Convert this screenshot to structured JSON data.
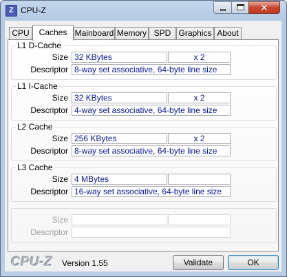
{
  "window": {
    "title": "CPU-Z",
    "icon_letter": "Z"
  },
  "tabs": [
    {
      "label": "CPU",
      "active": false
    },
    {
      "label": "Caches",
      "active": true
    },
    {
      "label": "Mainboard",
      "active": false
    },
    {
      "label": "Memory",
      "active": false
    },
    {
      "label": "SPD",
      "active": false
    },
    {
      "label": "Graphics",
      "active": false
    },
    {
      "label": "About",
      "active": false
    }
  ],
  "labels": {
    "size": "Size",
    "descriptor": "Descriptor"
  },
  "caches": {
    "l1d": {
      "title": "L1 D-Cache",
      "size": "32 KBytes",
      "count": "x 2",
      "descriptor": "8-way set associative, 64-byte line size"
    },
    "l1i": {
      "title": "L1 I-Cache",
      "size": "32 KBytes",
      "count": "x 2",
      "descriptor": "4-way set associative, 64-byte line size"
    },
    "l2": {
      "title": "L2 Cache",
      "size": "256 KBytes",
      "count": "x 2",
      "descriptor": "8-way set associative, 64-byte line size"
    },
    "l3": {
      "title": "L3 Cache",
      "size": "4 MBytes",
      "count": "",
      "descriptor": "16-way set associative, 64-byte line size"
    },
    "empty": {
      "size": "",
      "count": "",
      "descriptor": ""
    }
  },
  "footer": {
    "logo": "CPU-Z",
    "version": "Version 1.55",
    "validate_label": "Validate",
    "ok_label": "OK"
  }
}
